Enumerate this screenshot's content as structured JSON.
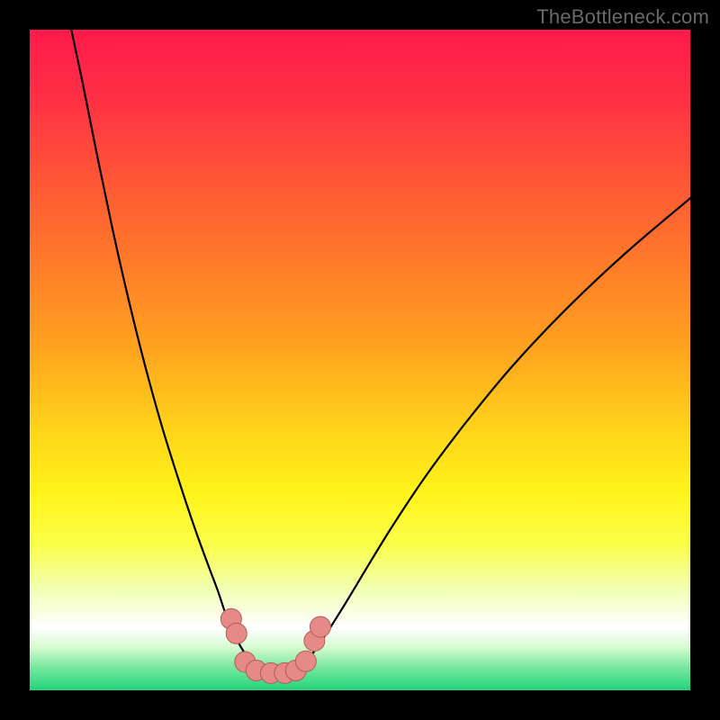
{
  "watermark": "TheBottleneck.com",
  "colors": {
    "frame": "#000000",
    "curve": "#000000",
    "marker_fill": "#e58a86",
    "marker_stroke": "#b55b57",
    "gradient_stops": [
      {
        "offset": 0.0,
        "color": "#ff1a4b"
      },
      {
        "offset": 0.1,
        "color": "#ff2f45"
      },
      {
        "offset": 0.22,
        "color": "#ff5436"
      },
      {
        "offset": 0.35,
        "color": "#ff7a2a"
      },
      {
        "offset": 0.48,
        "color": "#ffa21f"
      },
      {
        "offset": 0.6,
        "color": "#ffd21a"
      },
      {
        "offset": 0.7,
        "color": "#fff31a"
      },
      {
        "offset": 0.78,
        "color": "#fbff4a"
      },
      {
        "offset": 0.85,
        "color": "#f2ffb8"
      },
      {
        "offset": 0.905,
        "color": "#ffffff"
      },
      {
        "offset": 0.935,
        "color": "#d6fbd0"
      },
      {
        "offset": 0.965,
        "color": "#78e8a0"
      },
      {
        "offset": 1.0,
        "color": "#22d37a"
      }
    ]
  },
  "chart_data": {
    "type": "line",
    "title": "",
    "xlabel": "",
    "ylabel": "",
    "xlim": [
      0,
      100
    ],
    "ylim": [
      0,
      100
    ],
    "grid": false,
    "legend": false,
    "note": "Axes are normalized 0–100 because the source image has no tick labels; values are read proportionally from pixel positions. y is plotted with 0 at bottom.",
    "series": [
      {
        "name": "left-curve",
        "x": [
          6.3,
          8.0,
          10.0,
          12.5,
          15.0,
          17.5,
          20.0,
          22.5,
          25.0,
          27.0,
          28.5,
          29.5,
          30.3,
          31.2,
          32.0,
          33.0,
          34.0,
          35.0,
          36.0
        ],
        "y": [
          100.0,
          92.0,
          82.0,
          70.0,
          59.0,
          49.0,
          40.0,
          32.0,
          24.5,
          19.0,
          15.0,
          12.0,
          10.0,
          8.0,
          6.5,
          5.0,
          4.0,
          3.2,
          2.8
        ]
      },
      {
        "name": "right-curve",
        "x": [
          40.0,
          41.0,
          42.0,
          43.5,
          45.5,
          48.0,
          51.0,
          55.0,
          60.0,
          66.0,
          73.0,
          81.0,
          90.0,
          100.0
        ],
        "y": [
          2.8,
          3.5,
          4.5,
          6.5,
          9.5,
          13.5,
          18.5,
          25.0,
          32.5,
          40.5,
          49.0,
          57.5,
          66.0,
          74.5
        ]
      },
      {
        "name": "markers",
        "type": "scatter",
        "points": [
          {
            "x": 30.5,
            "y": 10.8
          },
          {
            "x": 31.3,
            "y": 8.6
          },
          {
            "x": 32.6,
            "y": 4.3
          },
          {
            "x": 34.3,
            "y": 3.0
          },
          {
            "x": 36.5,
            "y": 2.6
          },
          {
            "x": 38.6,
            "y": 2.6
          },
          {
            "x": 40.3,
            "y": 3.0
          },
          {
            "x": 41.8,
            "y": 4.4
          },
          {
            "x": 43.1,
            "y": 7.5
          },
          {
            "x": 44.0,
            "y": 9.6
          }
        ]
      }
    ]
  }
}
